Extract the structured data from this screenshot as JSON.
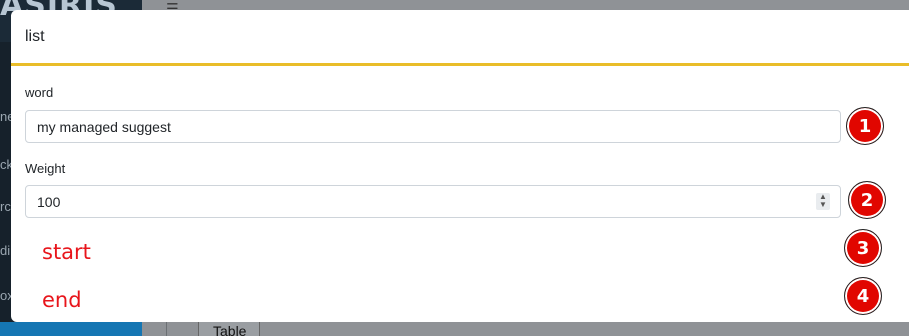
{
  "background": {
    "logo_text": "ASIRIS",
    "sidebar_fragments": [
      "ne",
      "ck",
      "rc",
      "di",
      "ox"
    ],
    "tab_label": "Table"
  },
  "modal": {
    "title": "list",
    "accent_color": "#e9bd29",
    "word_label": "word",
    "word_value": "my managed suggest",
    "weight_label": "Weight",
    "weight_value": "100",
    "start_text": "start",
    "end_text": "end"
  },
  "annotations": {
    "badge_color": "#e10600",
    "text_color": "#e8151b",
    "labels": [
      "1",
      "2",
      "3",
      "4"
    ]
  }
}
